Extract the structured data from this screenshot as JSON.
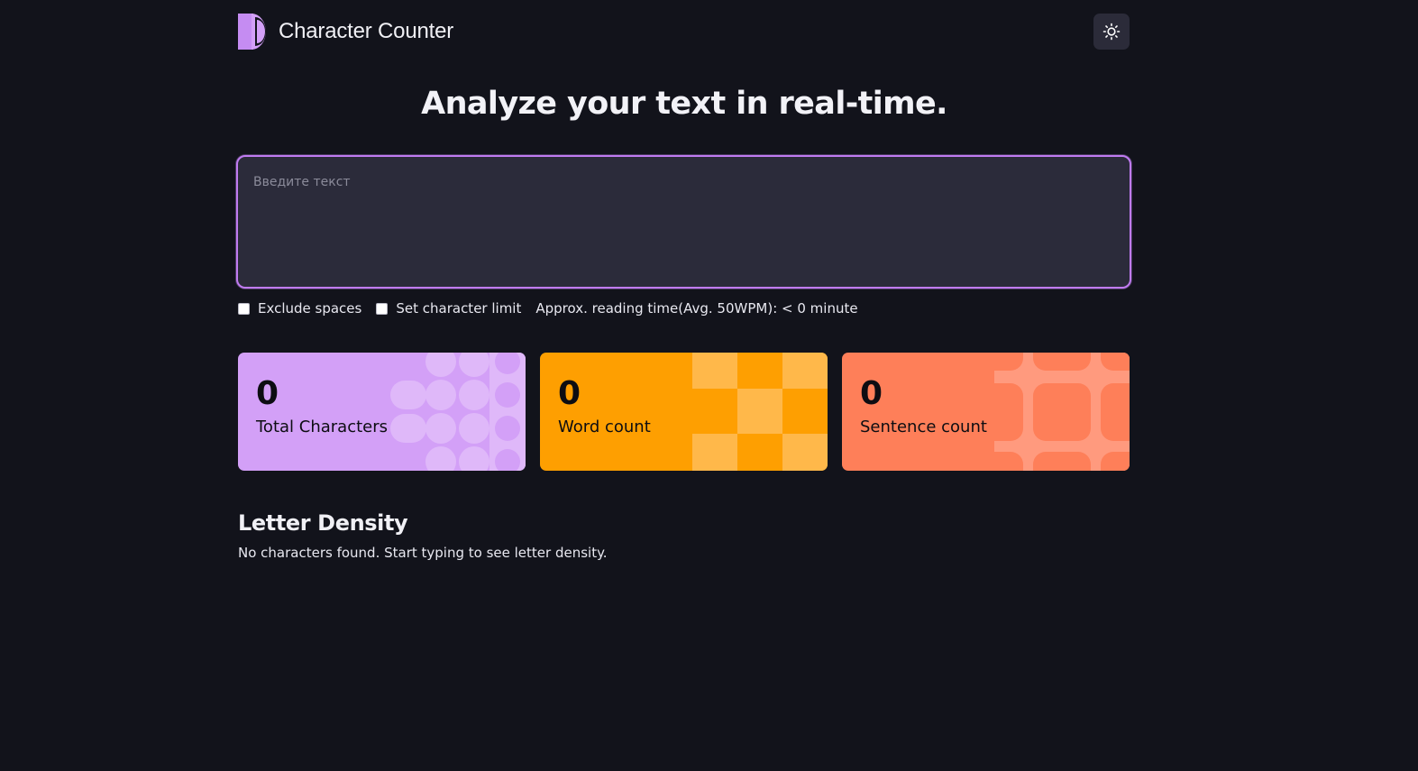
{
  "header": {
    "app_title": "Character Counter",
    "logo_icon": "half-circle-logo-icon",
    "theme_toggle_icon": "sun-icon"
  },
  "headline": "Analyze your text in real-time.",
  "editor": {
    "placeholder": "Введите текст",
    "value": ""
  },
  "options": {
    "exclude_spaces_label": "Exclude spaces",
    "exclude_spaces_checked": false,
    "char_limit_label": "Set character limit",
    "char_limit_checked": false,
    "reading_time": "Approx. reading time(Avg. 50WPM): < 0 minute"
  },
  "stats": [
    {
      "value": "0",
      "label": "Total Characters",
      "color": "#d3a0f7"
    },
    {
      "value": "0",
      "label": "Word count",
      "color": "#fe9f01"
    },
    {
      "value": "0",
      "label": "Sentence count",
      "color": "#fe7f59"
    }
  ],
  "density": {
    "title": "Letter Density",
    "empty_message": "No characters found. Start typing to see letter density."
  },
  "colors": {
    "background": "#12131b",
    "accent": "#c07bf1",
    "editor_bg": "#2b2b3a"
  }
}
